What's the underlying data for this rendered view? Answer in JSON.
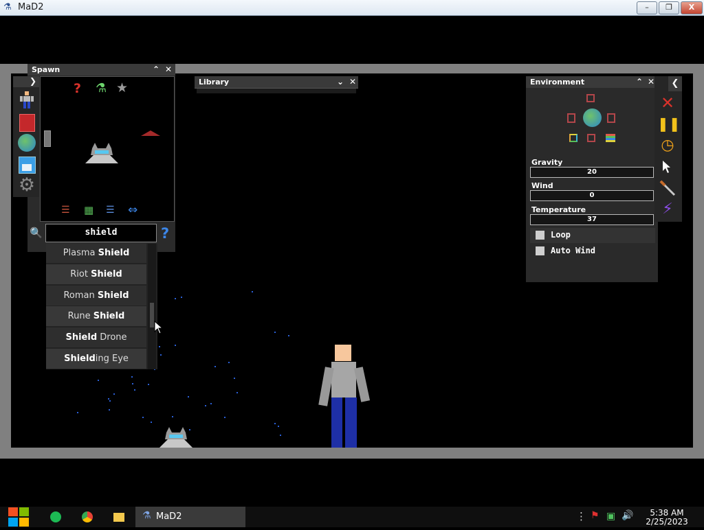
{
  "window": {
    "title": "MaD2",
    "buttons": [
      "–",
      "❐",
      "X"
    ]
  },
  "spawn_panel": {
    "title": "Spawn",
    "search_value": "shield",
    "results": [
      {
        "prefix": "Plasma ",
        "match": "Shield",
        "suffix": ""
      },
      {
        "prefix": "Riot ",
        "match": "Shield",
        "suffix": ""
      },
      {
        "prefix": "Roman ",
        "match": "Shield",
        "suffix": ""
      },
      {
        "prefix": "Rune ",
        "match": "Shield",
        "suffix": ""
      },
      {
        "prefix": "",
        "match": "Shield",
        "suffix": " Drone"
      },
      {
        "prefix": "",
        "match": "Shield",
        "suffix": "ing Eye"
      }
    ],
    "help_glyph": "?",
    "category_icons": [
      "question-icon",
      "flask-icon",
      "star-icon"
    ],
    "side_icons": [
      "ragdoll-icon",
      "book-icon",
      "globe-icon",
      "save-icon",
      "gear-icon"
    ],
    "bottom_icons": [
      "sliders-icon",
      "grid-icon",
      "list-icon",
      "swap-icon"
    ]
  },
  "library_panel": {
    "title": "Library"
  },
  "environment_panel": {
    "title": "Environment",
    "sliders": [
      {
        "label": "Gravity",
        "value": "20"
      },
      {
        "label": "Wind",
        "value": "0"
      },
      {
        "label": "Temperature",
        "value": "37"
      }
    ],
    "checkboxes": [
      {
        "label": "Loop",
        "checked": false
      },
      {
        "label": "Auto Wind",
        "checked": false
      }
    ]
  },
  "toolbar": {
    "icons": [
      "delete-icon",
      "pause-icon",
      "stopwatch-icon",
      "cursor-icon",
      "knife-icon",
      "lightning-icon"
    ],
    "colors": {
      "delete": "#d8322b",
      "pause": "#f2c21b",
      "timer": "#f0a21a",
      "lightning": "#8b4de6"
    }
  },
  "taskbar": {
    "app_label": "MaD2",
    "time": "5:38 AM",
    "date": "2/25/2023"
  }
}
